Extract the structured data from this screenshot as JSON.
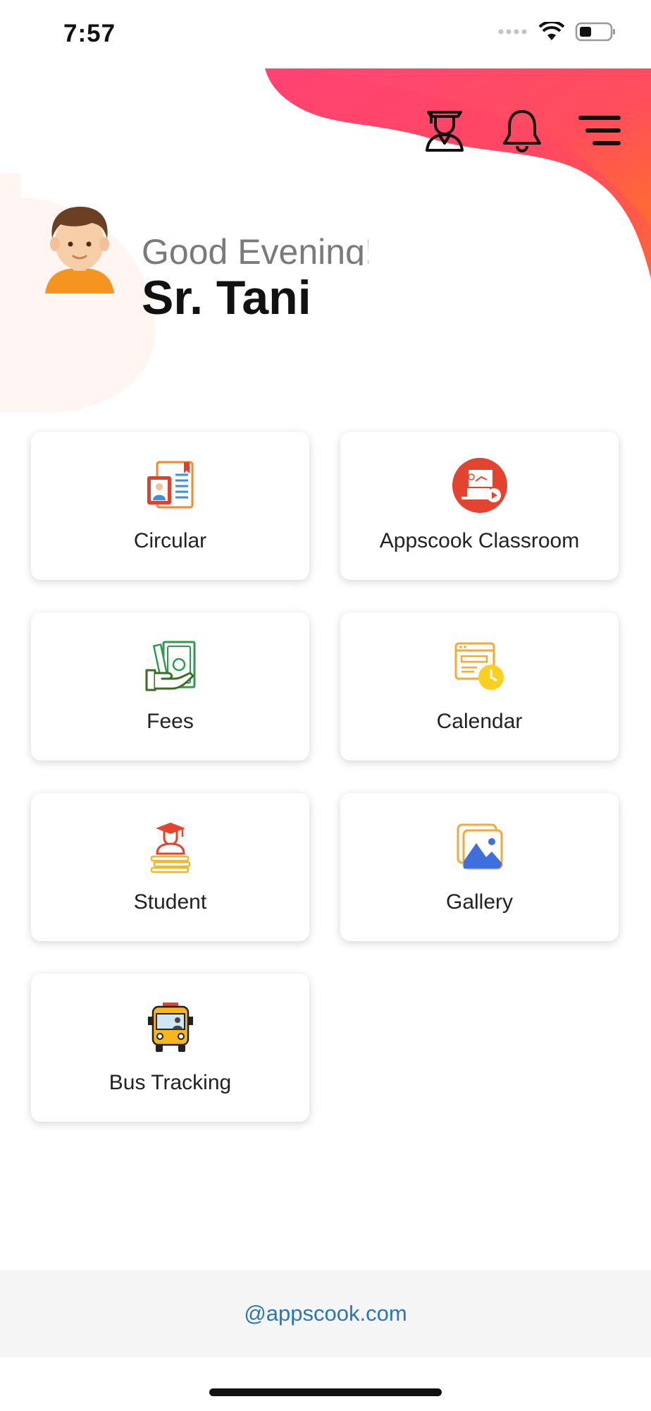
{
  "status_bar": {
    "time": "7:57"
  },
  "header": {
    "greeting": "Good Evening!",
    "user_name": "Sr. Tani",
    "icons": [
      "graduate-icon",
      "bell-icon",
      "menu-icon"
    ]
  },
  "tiles": [
    {
      "label": "Circular",
      "icon": "circular-icon"
    },
    {
      "label": "Appscook Classroom",
      "icon": "classroom-icon"
    },
    {
      "label": "Fees",
      "icon": "fees-icon"
    },
    {
      "label": "Calendar",
      "icon": "calendar-icon"
    },
    {
      "label": "Student",
      "icon": "student-icon"
    },
    {
      "label": "Gallery",
      "icon": "gallery-icon"
    },
    {
      "label": "Bus Tracking",
      "icon": "bus-icon"
    }
  ],
  "footer": {
    "link": "@appscook.com"
  },
  "colors": {
    "gradient_start": "#ff4a6e",
    "gradient_end": "#ff7a1e",
    "footer_link": "#2a77b5",
    "footer_bg": "#f5f5f5"
  }
}
